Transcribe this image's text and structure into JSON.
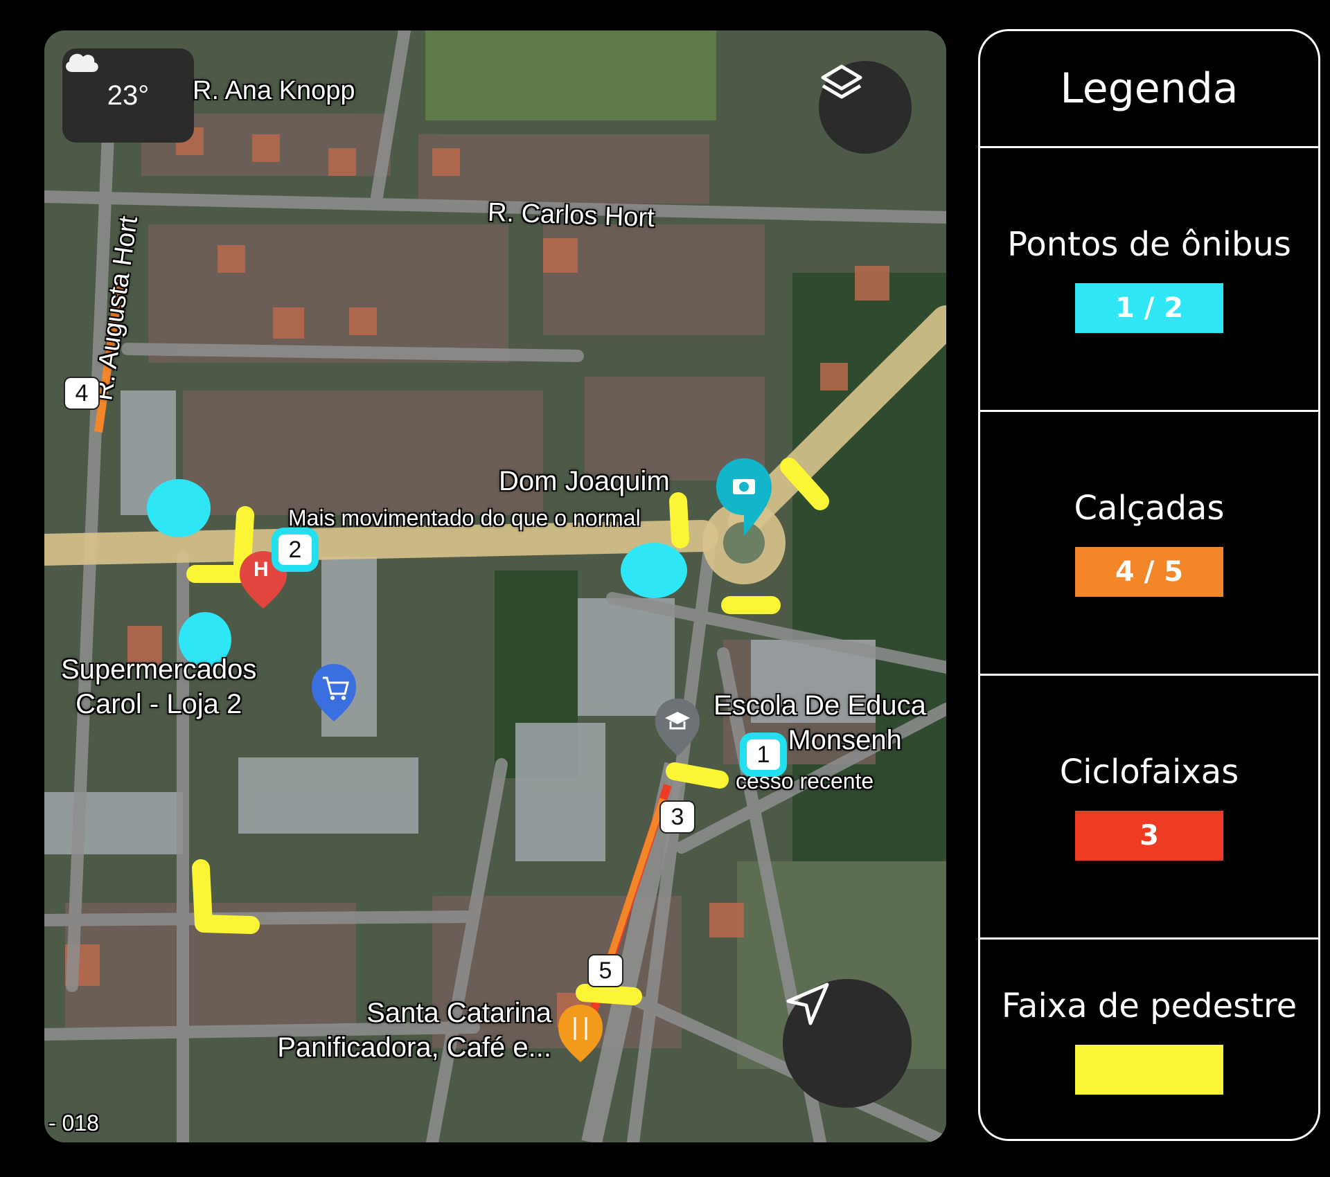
{
  "map": {
    "weather": {
      "temperature": "23°",
      "icon": "cloud-icon"
    },
    "streets": {
      "ana_knopp": "R. Ana Knopp",
      "carlos_hort": "R. Carlos Hort",
      "augusta_hort": "R. Augusta Hort"
    },
    "places": {
      "dom_joaquim": {
        "name": "Dom Joaquim",
        "note": "Mais movimentado do que o normal",
        "icon": "camera-pin-icon"
      },
      "supermercados": {
        "line1": "Supermercados",
        "line2": "Carol - Loja 2",
        "icon": "cart-pin-icon"
      },
      "escola": {
        "line1": "Escola De Educa",
        "line2": "ca Monsenh",
        "note": "cesso recente",
        "icon": "graduation-cap-pin-icon"
      },
      "santa_catarina": {
        "line1": "Santa Catarina",
        "line2": "Panificadora, Café e...",
        "icon": "fork-knife-pin-icon"
      },
      "hospital": {
        "icon": "hospital-pin-icon",
        "letter": "H"
      }
    },
    "markers": [
      "1",
      "2",
      "3",
      "4",
      "5"
    ],
    "scale_text": "- 018",
    "buttons": {
      "layers_icon": "layers-icon",
      "navigate_icon": "navigation-arrow-icon"
    }
  },
  "legend": {
    "title": "Legenda",
    "items": [
      {
        "label": "Pontos de ônibus",
        "value": "1 / 2",
        "color": "#2ee6f6"
      },
      {
        "label": "Calçadas",
        "value": "4 / 5",
        "color": "#f4862a"
      },
      {
        "label": "Ciclofaixas",
        "value": "3",
        "color": "#ee3b24"
      },
      {
        "label": "Faixa de pedestre",
        "value": "",
        "color": "#fbf535"
      }
    ]
  },
  "colors": {
    "bus_stop": "#2ee6f6",
    "sidewalk": "#f4862a",
    "bike_lane": "#ee3b24",
    "crosswalk": "#fbf535",
    "main_road": "#d8c38c"
  }
}
